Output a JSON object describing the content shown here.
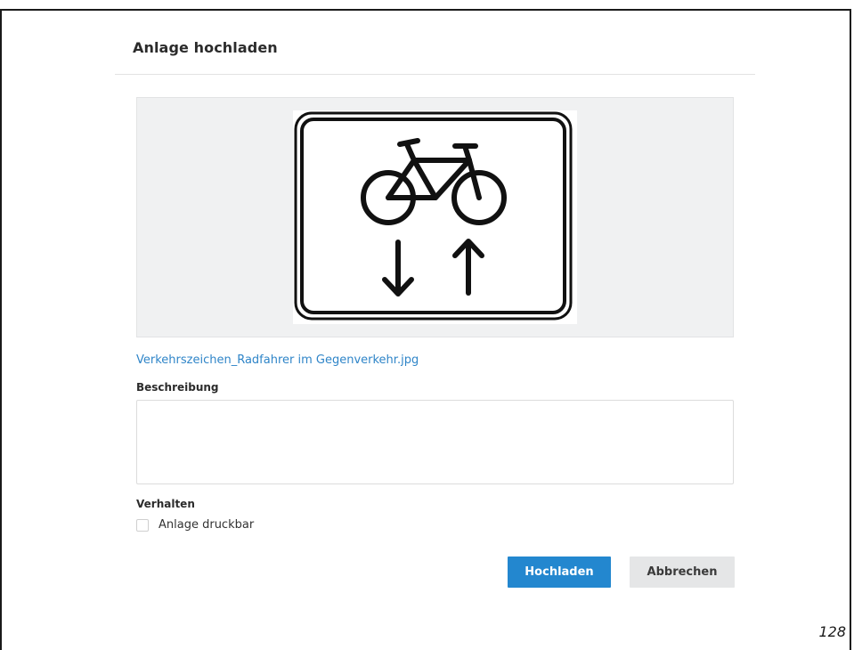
{
  "dialog": {
    "title": "Anlage hochladen"
  },
  "preview": {
    "image_description_icon": "traffic-sign-bicycle-two-way-icon"
  },
  "file": {
    "name": "Verkehrszeichen_Radfahrer im Gegenverkehr.jpg"
  },
  "description": {
    "label": "Beschreibung",
    "value": ""
  },
  "behavior": {
    "label": "Verhalten",
    "printable_label": "Anlage druckbar",
    "printable_checked": false
  },
  "buttons": {
    "upload_label": "Hochladen",
    "cancel_label": "Abbrechen"
  },
  "colors": {
    "primary": "#2387cf",
    "link": "#2f85c8",
    "secondary_button": "#e5e6e7"
  },
  "page": {
    "number": "128"
  }
}
